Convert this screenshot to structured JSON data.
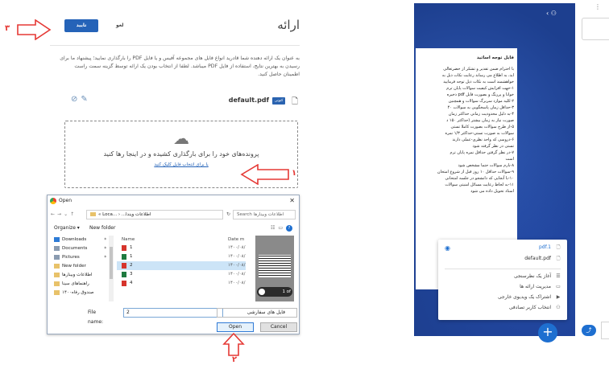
{
  "left_panel": {
    "title": "ارائه",
    "confirm_label": "تایید",
    "cancel_label": "لغو",
    "description": "به عنوان یک ارائه دهنده شما قادرید انواع فایل های مجموعه آفیس و یا فایل PDF را بارگذاری نمایید؛ پیشنهاد ما برای رسیدن به بهترین نتایج، استفاده از فایل PDF میباشد. لطفا از انتخاب بودن یک ارائه توسط گزینه سمت راست اطمینان حاصل کنید.",
    "file_name": "default.pdf",
    "file_badge": "کنونی",
    "drop_text": "پرونده‌های خود را برای بارگذاری کشیده و در اینجا رها کنید",
    "drop_link": "یا برای انتخاب فایل کلیک کنید"
  },
  "annotations": {
    "n1": "۱",
    "n2": "۲",
    "n3": "۳"
  },
  "open_dialog": {
    "title": "Open",
    "path_text": "« Loca... › ...اطلاعات ویندا",
    "search_placeholder": "Search اطلاعات وبینارها",
    "organize_label": "Organize ▾",
    "new_folder_label": "New folder",
    "nav_items": [
      {
        "label": "Downloads",
        "icon": "download-icon",
        "color": "#2d7bd6"
      },
      {
        "label": "Documents",
        "icon": "documents-icon",
        "color": "#8a9bb0"
      },
      {
        "label": "Pictures",
        "icon": "pictures-icon",
        "color": "#8a9bb0"
      },
      {
        "label": "New folder",
        "icon": "folder-icon",
        "color": "#e8c26a"
      },
      {
        "label": "اطلاعات وبینارها",
        "icon": "folder-icon",
        "color": "#e8c26a"
      },
      {
        "label": "راهنماهای سینا",
        "icon": "folder-icon",
        "color": "#e8c26a"
      },
      {
        "label": "صندوق رفاه۱۴۰۰",
        "icon": "folder-icon",
        "color": "#e8c26a"
      }
    ],
    "col_name": "Name",
    "col_date": "Date m",
    "files": [
      {
        "name": "1",
        "type": "pdf",
        "date": "۱۴۰۰/۰۸/"
      },
      {
        "name": "1",
        "type": "xls",
        "date": "۱۴۰۰/۰۸/"
      },
      {
        "name": "2",
        "type": "pdf",
        "date": "۱۴۰۰/۰۸/",
        "selected": true
      },
      {
        "name": "3",
        "type": "xls",
        "date": "۱۴۰۰/۰۸/"
      },
      {
        "name": "4",
        "type": "pdf",
        "date": "۱۴۰۰/۰۸/"
      }
    ],
    "preview_page_label": "1 of",
    "file_name_label": "File name:",
    "file_name_value": "2",
    "file_type_value": "فایل های سفارشی",
    "open_label": "Open",
    "cancel_label": "Cancel"
  },
  "editor": {
    "doc_tab": "فایل توجه اساتید",
    "doc_heading": "فایل توجه اساتید",
    "doc_body": "با احترام ضمن تقدیر و تشکر از حضرتعالی\nاید، به اطلاع می رساند رعایت نکات ذیل به\nخواهشمند است به نکات ذیل توجه فرمایید\n۱-جهت افزایش کیفیت سوالات پایان ترم\nخوانا و پررنگ و بصورت فایل pdf ذخیره\n۲-کلیه موارد سربرگ سوالات و همچنین\n۳-حداقل زمان پاسخگویی به سوالات ۴۰\n۴-به دلیل محدودیت زمانی حداکثر زمان\nصورت نیاز به زمان بیشتر (حداکثر ۱۵۰ د\n۵-از طرح سوالات بصورت کاملا تستی\nسوالات به صورت تستی-حداکثر ۱/۳ نمره\n۶-دروسی که واحد نظری-عملی دارند\nتستی در نظر گرفته شود\n۷-در نظر گرفتن حداقل نمره پایان ترم\nاست\n۸-بارم سوالات حتما مشخص شود\n۹-سوالات حداقل ۱۰ روز قبل از شروع امتحان\n۱۰-با آنجایی که دانشجو در جلسه امتحانی\n۱۱-به لحاظ رعایت مسائل امنیتی سوالات\nاستاد تحویل داده می شود"
  },
  "popup": {
    "files": [
      {
        "name": "pdf.1",
        "active": true
      },
      {
        "name": "default.pdf",
        "active": false
      }
    ],
    "actions": [
      {
        "label": "آغاز یک نظرسنجی",
        "icon": "poll-icon"
      },
      {
        "label": "مدیریت ارائه ها",
        "icon": "presentation-icon"
      },
      {
        "label": "اشتراک یک ویدیوی خارجی",
        "icon": "video-icon"
      },
      {
        "label": "انتخاب کاربر تصادفی",
        "icon": "user-icon"
      }
    ]
  }
}
